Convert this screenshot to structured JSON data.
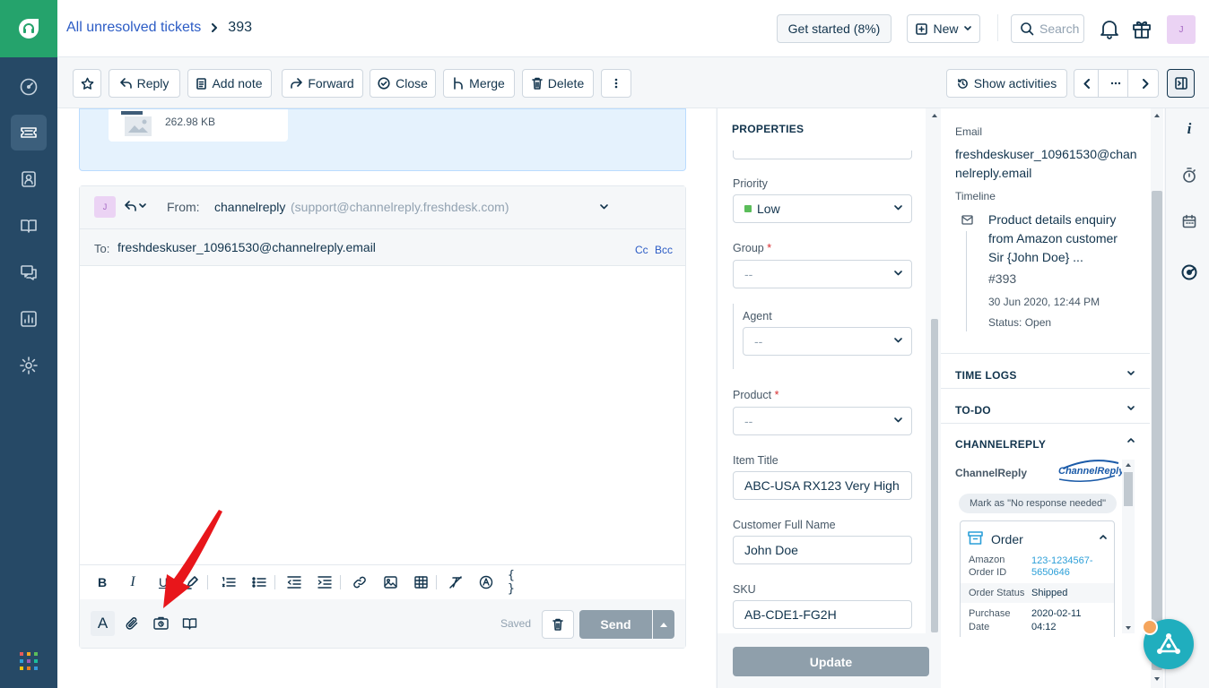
{
  "header": {
    "breadcrumb_link": "All unresolved tickets",
    "ticket_number": "393",
    "get_started": "Get started (8%)",
    "new_label": "New",
    "search_placeholder": "Search",
    "avatar_initial": "J"
  },
  "toolbar": {
    "reply": "Reply",
    "add_note": "Add note",
    "forward": "Forward",
    "close": "Close",
    "merge": "Merge",
    "delete": "Delete",
    "show_activities": "Show activities"
  },
  "attachment": {
    "size": "262.98 KB"
  },
  "editor": {
    "avatar_initial": "J",
    "from_label": "From:",
    "from_name": "channelreply",
    "from_email": "(support@channelreply.freshdesk.com)",
    "to_label": "To:",
    "to_email": "freshdeskuser_10961530@channelreply.email",
    "cc": "Cc",
    "bcc": "Bcc",
    "saved": "Saved",
    "send": "Send"
  },
  "properties": {
    "title": "PROPERTIES",
    "priority_label": "Priority",
    "priority_value": "Low",
    "priority_color": "#5bbd5a",
    "group_label": "Group",
    "group_value": "--",
    "agent_label": "Agent",
    "agent_value": "--",
    "product_label": "Product",
    "product_value": "--",
    "item_title_label": "Item Title",
    "item_title_value": "ABC-USA RX123 Very High",
    "customer_name_label": "Customer Full Name",
    "customer_name_value": "John Doe",
    "sku_label": "SKU",
    "sku_value": "AB-CDE1-FG2H",
    "update": "Update"
  },
  "contact": {
    "email_label": "Email",
    "email_line1": "freshdeskuser_10961530@chan",
    "email_line2": "nelreply.email",
    "timeline_label": "Timeline",
    "timeline_title_1": "Product details enquiry",
    "timeline_title_2": "from Amazon customer",
    "timeline_title_3": "Sir {John Doe} ...",
    "timeline_ticket": "#393",
    "timeline_date": "30 Jun 2020, 12:44 PM",
    "timeline_status": "Status: Open"
  },
  "sections": {
    "time_logs": "TIME LOGS",
    "todo": "TO-DO",
    "channelreply": "CHANNELREPLY"
  },
  "channelreply_app": {
    "app_name": "ChannelReply",
    "logo_text": "ChannelReply",
    "mark_button": "Mark as \"No response needed\"",
    "order_title": "Order",
    "order_id_label_1": "Amazon",
    "order_id_label_2": "Order ID",
    "order_id_value_1": "123-1234567-",
    "order_id_value_2": "5650646",
    "order_status_label": "Order Status",
    "order_status_value": "Shipped",
    "purchase_date_label_1": "Purchase",
    "purchase_date_label_2": "Date",
    "purchase_date_value_1": "2020-02-11",
    "purchase_date_value_2": "04:12"
  }
}
